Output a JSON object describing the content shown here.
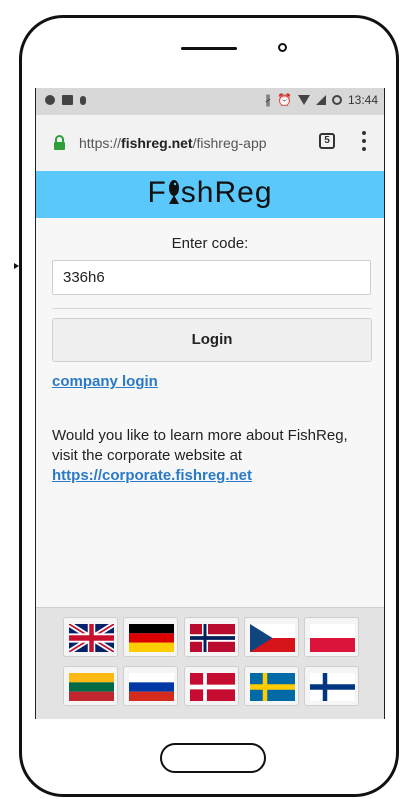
{
  "statusbar": {
    "time": "13:44"
  },
  "browser": {
    "url_prefix": "https://",
    "url_domain": "fishreg.net",
    "url_path": "/fishreg-app",
    "tab_count": "5"
  },
  "app": {
    "logo_prefix": "F",
    "logo_suffix": "shReg",
    "enter_code_label": "Enter code:",
    "code_value": "336h6",
    "login_label": "Login",
    "company_login_label": "company login",
    "info_text": "Would you like to learn more about FishReg, visit the corporate website at",
    "info_link": "https://corporate.fishreg.net"
  },
  "languages": [
    "English",
    "German",
    "Norwegian",
    "Czech",
    "Polish",
    "Lithuanian",
    "Russian",
    "Danish",
    "Swedish",
    "Finnish"
  ],
  "colors": {
    "header": "#5ac8fa",
    "link": "#2a7ac8"
  }
}
